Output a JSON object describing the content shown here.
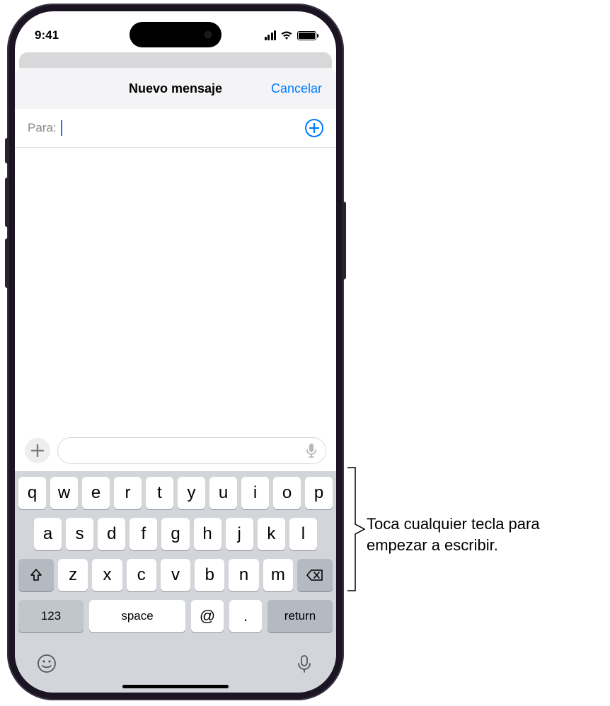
{
  "status": {
    "time": "9:41"
  },
  "header": {
    "title": "Nuevo mensaje",
    "cancel": "Cancelar"
  },
  "recipient": {
    "label": "Para:"
  },
  "keyboard": {
    "row1": [
      "q",
      "w",
      "e",
      "r",
      "t",
      "y",
      "u",
      "i",
      "o",
      "p"
    ],
    "row2": [
      "a",
      "s",
      "d",
      "f",
      "g",
      "h",
      "j",
      "k",
      "l"
    ],
    "row3": [
      "z",
      "x",
      "c",
      "v",
      "b",
      "n",
      "m"
    ],
    "numeric": "123",
    "space": "space",
    "at": "@",
    "dot": ".",
    "return": "return"
  },
  "callout": {
    "line1": "Toca cualquier tecla para",
    "line2": "empezar a escribir."
  }
}
